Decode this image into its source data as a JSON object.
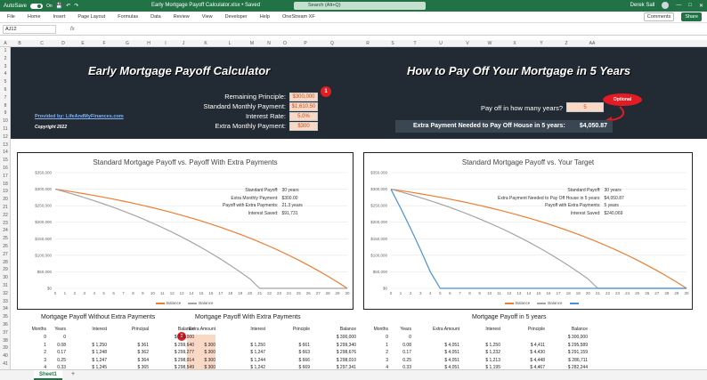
{
  "window": {
    "autosave_label": "AutoSave",
    "autosave_state": "On",
    "title": "Early Mortgage Payoff Calculator.xlsx • Saved",
    "search_placeholder": "Search (Alt+Q)",
    "user_name": "Derek Sall"
  },
  "ribbon": {
    "tabs": [
      "File",
      "Home",
      "Insert",
      "Page Layout",
      "Formulas",
      "Data",
      "Review",
      "View",
      "Developer",
      "Help",
      "OneStream XF"
    ],
    "comments_label": "Comments",
    "share_label": "Share"
  },
  "formula_bar": {
    "name_box": "AJ12",
    "fx": "fx"
  },
  "columns": [
    "A",
    "B",
    "C",
    "D",
    "E",
    "F",
    "G",
    "H",
    "I",
    "J",
    "K",
    "L",
    "M",
    "N",
    "O",
    "P",
    "Q",
    "R",
    "S",
    "T",
    "U",
    "V",
    "W",
    "X",
    "Y",
    "Z",
    "AA"
  ],
  "rows": [
    "1",
    "2",
    "3",
    "4",
    "5",
    "6",
    "7",
    "8",
    "9",
    "10",
    "11",
    "12",
    "13",
    "14",
    "15",
    "16",
    "17",
    "18",
    "19",
    "20",
    "21",
    "22",
    "23",
    "24",
    "25",
    "26",
    "27",
    "28",
    "29",
    "30",
    "31",
    "32",
    "33",
    "34",
    "35",
    "36",
    "37",
    "38",
    "39",
    "40",
    "41"
  ],
  "left_panel": {
    "title": "Early Mortgage Payoff Calculator",
    "labels": [
      "Remaining Principle:",
      "Standard Monthly Payment:",
      "Interest Rate:",
      "Extra Monthly Payment:"
    ],
    "values": [
      "$300,000",
      "$1,610.50",
      "5.0%",
      "$300"
    ],
    "badge": "1",
    "provided_by": "Provided by: LifeAndMyFinances.com",
    "copyright": "Copyright 2022"
  },
  "right_panel": {
    "title": "How to Pay Off Your Mortgage in 5 Years",
    "years_label": "Pay off in how many years?",
    "years_value": "5",
    "optional_label": "Optional",
    "extra_label": "Extra Payment Needed to Pay Off House in 5 years:",
    "extra_value": "$4,050.87"
  },
  "chart1_info": {
    "labels": [
      "Standard Payoff:",
      "Extra Monthly Payment:",
      "Payoff with Extra Payments:",
      "Interest Saved:"
    ],
    "values": [
      "30 years",
      "$300.00",
      "21.3 years",
      "$91,731"
    ]
  },
  "chart2_info": {
    "labels": [
      "Standard Payoff:",
      "Extra Payment Needed to Pay Off House in 5 years:",
      "Payoff with Extra Payments:",
      "Interest Saved:"
    ],
    "values": [
      "30 years",
      "$4,050.87",
      "5 years",
      "$240,069"
    ]
  },
  "chart_data": [
    {
      "type": "line",
      "title": "Standard Mortgage Payoff vs. Payoff With Extra Payments",
      "x": [
        0,
        1,
        2,
        3,
        4,
        5,
        6,
        7,
        8,
        9,
        10,
        11,
        12,
        13,
        14,
        15,
        16,
        17,
        18,
        19,
        20,
        21,
        22,
        23,
        24,
        25,
        26,
        27,
        28,
        29,
        30
      ],
      "ylim": [
        0,
        350000
      ],
      "yticks": [
        "$0",
        "$50,000",
        "$100,000",
        "$150,000",
        "$200,000",
        "$250,000",
        "$300,000",
        "$350,000"
      ],
      "series": [
        {
          "name": "Balance",
          "color": "#ed7d31",
          "values": [
            300000,
            295573,
            290920,
            286029,
            280888,
            275484,
            269803,
            263832,
            257555,
            250957,
            244021,
            236730,
            229066,
            221011,
            212543,
            203642,
            194285,
            184450,
            174111,
            163243,
            151819,
            139811,
            127188,
            113920,
            99972,
            85312,
            69900,
            53701,
            36672,
            18773,
            0
          ]
        },
        {
          "name": "Balance",
          "color": "#a5a5a5",
          "values": [
            300000,
            291893,
            283372,
            274415,
            264999,
            255102,
            244698,
            233762,
            222266,
            210182,
            197479,
            184126,
            170090,
            155336,
            139827,
            123524,
            106387,
            88373,
            69437,
            49533,
            28610,
            0,
            0,
            0,
            0,
            0,
            0,
            0,
            0,
            0,
            0
          ]
        }
      ]
    },
    {
      "type": "line",
      "title": "Standard Mortgage Payoff vs. Your Target",
      "x": [
        0,
        1,
        2,
        3,
        4,
        5,
        6,
        7,
        8,
        9,
        10,
        11,
        12,
        13,
        14,
        15,
        16,
        17,
        18,
        19,
        20,
        21,
        22,
        23,
        24,
        25,
        26,
        27,
        28,
        29,
        30
      ],
      "ylim": [
        0,
        350000
      ],
      "yticks": [
        "$0",
        "$50,000",
        "$100,000",
        "$150,000",
        "$200,000",
        "$250,000",
        "$300,000",
        "$350,000"
      ],
      "series": [
        {
          "name": "Balance",
          "color": "#ed7d31",
          "values": [
            300000,
            295573,
            290920,
            286029,
            280888,
            275484,
            269803,
            263832,
            257555,
            250957,
            244021,
            236730,
            229066,
            221011,
            212543,
            203642,
            194285,
            184450,
            174111,
            163243,
            151819,
            139811,
            127188,
            113920,
            99972,
            85312,
            69900,
            53701,
            36672,
            18773,
            0
          ]
        },
        {
          "name": "Balance",
          "color": "#a5a5a5",
          "values": [
            300000,
            291893,
            283372,
            274415,
            264999,
            255102,
            244698,
            233762,
            222266,
            210182,
            197479,
            184126,
            170090,
            155336,
            139827,
            123524,
            106387,
            88373,
            69437,
            49533,
            28610,
            0,
            0,
            0,
            0,
            0,
            0,
            0,
            0,
            0,
            0
          ]
        },
        {
          "name": "",
          "color": "#4a90d9",
          "values": [
            300000,
            242000,
            181000,
            117000,
            50000,
            0,
            0,
            0,
            0,
            0,
            0,
            0,
            0,
            0,
            0,
            0,
            0,
            0,
            0,
            0,
            0,
            0,
            0,
            0,
            0,
            0,
            0,
            0,
            0,
            0,
            0
          ]
        }
      ]
    }
  ],
  "tables": {
    "t1": {
      "title": "Mortgage Payoff Without Extra Payments",
      "headers": [
        "Months",
        "Years",
        "Interest",
        "Principal",
        "Balance"
      ],
      "rows": [
        [
          "0",
          "0",
          "",
          "",
          "$ 300,000"
        ],
        [
          "1",
          "0.08",
          "$ 1,250",
          "$ 361",
          "$ 299,640"
        ],
        [
          "2",
          "0.17",
          "$ 1,248",
          "$ 362",
          "$ 299,277"
        ],
        [
          "3",
          "0.25",
          "$ 1,247",
          "$ 364",
          "$ 298,914"
        ],
        [
          "4",
          "0.33",
          "$ 1,245",
          "$ 365",
          "$ 298,549"
        ]
      ]
    },
    "t2": {
      "title": "Mortgage Payoff With Extra Payments",
      "badge": "2",
      "headers": [
        "Extra Amount",
        "Interest",
        "Principle",
        "Balance"
      ],
      "rows": [
        [
          "",
          "",
          "",
          "$ 300,000"
        ],
        [
          "$ 300",
          "$ 1,250",
          "$ 661",
          "$ 299,340"
        ],
        [
          "$ 300",
          "$ 1,247",
          "$ 663",
          "$ 298,676"
        ],
        [
          "$ 300",
          "$ 1,244",
          "$ 666",
          "$ 298,010"
        ],
        [
          "$ 300",
          "$ 1,242",
          "$ 669",
          "$ 297,341"
        ]
      ]
    },
    "t3": {
      "title": "Mortgage Payoff in 5 years",
      "headers": [
        "Months",
        "Years",
        "Extra Amount",
        "Interest",
        "Principle",
        "Balance"
      ],
      "rows": [
        [
          "0",
          "0",
          "",
          "",
          "",
          "$ 300,000"
        ],
        [
          "1",
          "0.08",
          "$ 4,051",
          "$ 1,250",
          "$ 4,411",
          "$ 295,589"
        ],
        [
          "2",
          "0.17",
          "$ 4,051",
          "$ 1,232",
          "$ 4,430",
          "$ 291,159"
        ],
        [
          "3",
          "0.25",
          "$ 4,051",
          "$ 1,213",
          "$ 4,448",
          "$ 286,711"
        ],
        [
          "4",
          "0.33",
          "$ 4,051",
          "$ 1,195",
          "$ 4,467",
          "$ 282,244"
        ]
      ]
    }
  },
  "sheet_tab": "Sheet1",
  "add_sheet": "+"
}
